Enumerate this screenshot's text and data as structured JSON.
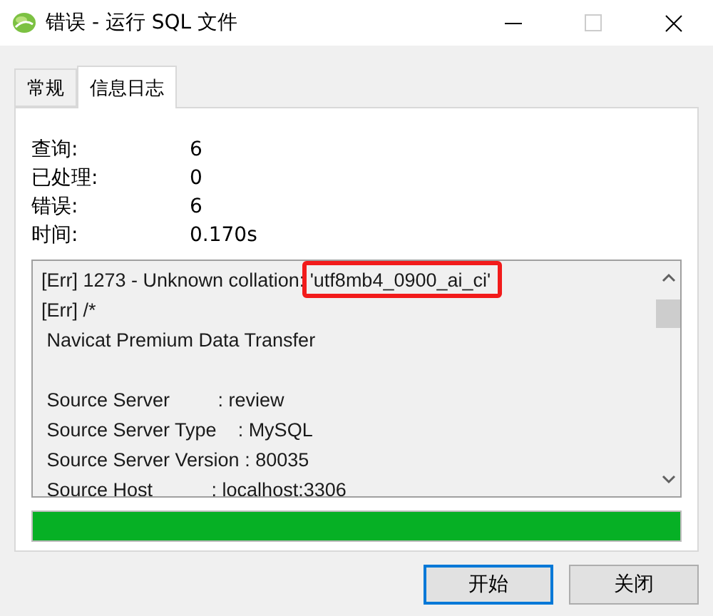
{
  "window": {
    "title": "错误 - 运行 SQL 文件"
  },
  "tabs": [
    {
      "label": "常规",
      "selected": false
    },
    {
      "label": "信息日志",
      "selected": true
    }
  ],
  "stats": [
    {
      "label": "查询:",
      "value": "6"
    },
    {
      "label": "已处理:",
      "value": "0"
    },
    {
      "label": "错误:",
      "value": "6"
    },
    {
      "label": "时间:",
      "value": "0.170s"
    }
  ],
  "log": [
    {
      "kind": "text",
      "text": "[Err] 1273 - Unknown collation: ",
      "highlight": "'utf8mb4_0900_ai_ci'"
    },
    {
      "kind": "text",
      "text": "[Err] /*"
    },
    {
      "kind": "text",
      "text": " Navicat Premium Data Transfer"
    },
    {
      "kind": "blank"
    },
    {
      "kind": "text",
      "text": " Source Server         : review"
    },
    {
      "kind": "text",
      "text": " Source Server Type    : MySQL"
    },
    {
      "kind": "text",
      "text": " Source Server Version : 80035"
    },
    {
      "kind": "text",
      "text": " Source Host           : localhost:3306"
    }
  ],
  "progress": {
    "level": 1
  },
  "buttons": [
    {
      "label": "开始",
      "selected": true
    },
    {
      "label": "关闭",
      "selected": false
    }
  ]
}
